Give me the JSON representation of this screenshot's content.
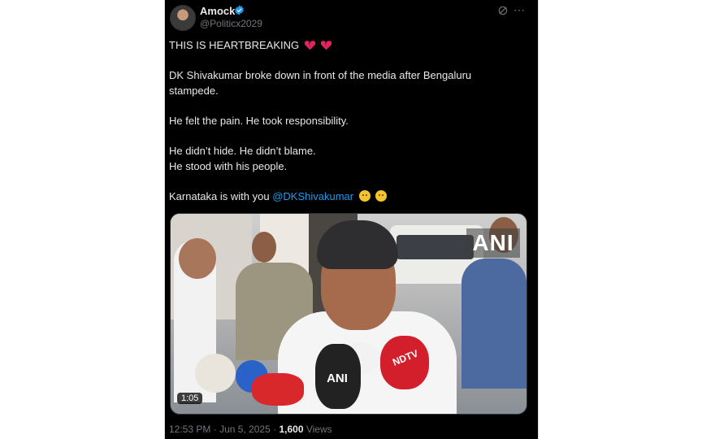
{
  "tweet": {
    "author_name": "Amock",
    "author_handle": "@Politicx2029",
    "lines": [
      "THIS IS HEARTBREAKING",
      "DK Shivakumar broke down in front of the media after Bengaluru",
      "stampede.",
      "He felt the pain. He took responsibility.",
      "He didn’t hide. He didn’t blame.",
      "He stood with his people."
    ],
    "last_line_prefix": "Karnataka is with you ",
    "mention": "@DKShivakumar",
    "icons": [
      "verified-badge-icon",
      "grok-icon",
      "more-icon",
      "broken-heart-icon",
      "pleading-face-icon"
    ],
    "accent_color": "#1d9bf0"
  },
  "media": {
    "duration": "1:05",
    "watermark": "ANI",
    "mic_label_ani": "ANI",
    "mic_label_ndtv": "NDTV"
  },
  "meta": {
    "time": "12:53 PM",
    "separator": "·",
    "date": "Jun 5, 2025",
    "views_count": "1,600",
    "views_label": "Views"
  }
}
